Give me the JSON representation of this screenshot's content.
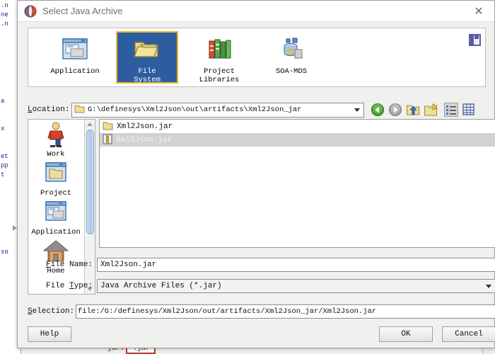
{
  "window": {
    "title": "Select Java Archive",
    "app_icon": "jdeveloper-icon",
    "close_label": "✕"
  },
  "source_tabs": [
    {
      "label": "Application",
      "icon": "application-windows-icon",
      "selected": false
    },
    {
      "label": "File\nSystem",
      "label_line1": "File",
      "label_line2": "System",
      "icon": "folder-open-icon",
      "selected": true
    },
    {
      "label": "Project\nLibraries",
      "label_line1": "Project",
      "label_line2": "Libraries",
      "icon": "libraries-books-icon",
      "selected": false
    },
    {
      "label": "SOA-MDS",
      "label_line1": "SOA-MDS",
      "label_line2": "",
      "icon": "soa-mds-database-icon",
      "selected": false
    }
  ],
  "layout_toggle": {
    "icon": "panel-layout-icon"
  },
  "location": {
    "label": "Location:",
    "label_mnemonic": "L",
    "value": "G:\\definesys\\Xml2Json\\out\\artifacts\\Xml2Json_jar",
    "folder_icon": "folder-icon",
    "dropdown_icon": "chevron-down-icon"
  },
  "toolbar": [
    {
      "name": "back-button",
      "icon": "arrow-left-circle-green-icon",
      "enabled": true,
      "pressed": false
    },
    {
      "name": "forward-button",
      "icon": "arrow-right-circle-grey-icon",
      "enabled": false,
      "pressed": false
    },
    {
      "name": "up-one-level-button",
      "icon": "folder-up-arrow-icon",
      "enabled": true,
      "pressed": false
    },
    {
      "name": "new-folder-button",
      "icon": "folder-new-star-icon",
      "enabled": true,
      "pressed": false
    },
    {
      "name": "list-view-button",
      "icon": "list-view-icon",
      "enabled": true,
      "pressed": true
    },
    {
      "name": "details-view-button",
      "icon": "details-grid-view-icon",
      "enabled": true,
      "pressed": false
    }
  ],
  "shortcuts": [
    {
      "label": "Work",
      "icon": "person-work-icon"
    },
    {
      "label": "Project",
      "icon": "project-window-folder-icon"
    },
    {
      "label": "Application",
      "icon": "application-windows-icon"
    },
    {
      "label": "Home",
      "icon": "home-house-icon"
    }
  ],
  "files": [
    {
      "name": "Xml2Json.jar",
      "icon": "folder-icon",
      "type": "folder",
      "selected": false
    },
    {
      "name": "Xml2Json.jar",
      "icon": "jar-archive-icon",
      "type": "archive",
      "selected": true
    }
  ],
  "file_name": {
    "label": "File Name:",
    "label_mnemonic": "F",
    "value": "Xml2Json.jar"
  },
  "file_type": {
    "label": "File Type:",
    "label_mnemonic": "T",
    "value": "Java Archive Files (*.jar)",
    "dropdown_icon": "chevron-down-icon"
  },
  "selection": {
    "label": "Selection:",
    "label_mnemonic": "S",
    "value": "file:/G:/definesys/Xml2Json/out/artifacts/Xml2Json_jar/Xml2Json.jar"
  },
  "buttons": {
    "help": "Help",
    "ok": "OK",
    "cancel": "Cancel"
  },
  "background": {
    "code_lines": [
      ".n",
      "ne",
      ".n",
      "",
      "",
      "a",
      "x",
      "",
      "et",
      "pp",
      "t",
      "",
      "",
      "",
      "so"
    ],
    "bottom_label": "jar:",
    "bottom_field_value": "*.jar"
  },
  "colors": {
    "tab_selected_bg": "#2e5d9f",
    "tab_selected_border": "#e8bb2a",
    "row_selected_bg": "#d2d2d2",
    "dialog_bg": "#f0f0ee",
    "error_border": "#c0392b"
  }
}
